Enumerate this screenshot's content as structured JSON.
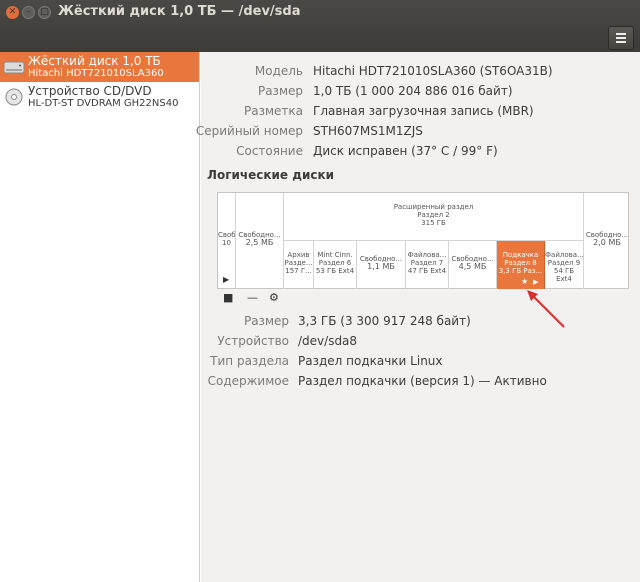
{
  "window": {
    "title": "Жёсткий диск 1,0 ТБ — /dev/sda"
  },
  "sidebar": {
    "devices": [
      {
        "name": "Жёсткий диск 1,0 ТБ",
        "sub": "Hitachi HDT721010SLA360",
        "icon": "hard-disk-icon",
        "selected": true
      },
      {
        "name": "Устройство CD/DVD",
        "sub": "HL-DT-ST DVDRAM GH22NS40",
        "icon": "optical-disc-icon",
        "selected": false
      }
    ]
  },
  "disk_info": [
    {
      "key": "Модель",
      "value": "Hitachi HDT721010SLA360 (ST6OA31B)"
    },
    {
      "key": "Размер",
      "value": "1,0 ТБ (1 000 204 886 016 байт)"
    },
    {
      "key": "Разметка",
      "value": "Главная загрузочная запись (MBR)"
    },
    {
      "key": "Серийный номер",
      "value": "STH607MS1M1ZJS"
    },
    {
      "key": "Состояние",
      "value": "Диск исправен (37° C / 99° F)"
    }
  ],
  "volumes_title": "Логические диски",
  "partitions": {
    "top_row": [
      {
        "l1": "Своб",
        "l2": "10"
      },
      {
        "l1": "Свободно...",
        "l2": "2,5 МБ"
      },
      {
        "l1": "Расширенный раздел",
        "l2": "Раздел 2",
        "l3": "315 ГБ"
      },
      {
        "l1": "Свободно...",
        "l2": "2,0 МБ"
      }
    ],
    "inner_row": [
      {
        "l1": "Архив",
        "l2": "Разде...",
        "l3": "157 Г..."
      },
      {
        "l1": "Mint Cinn.",
        "l2": "Раздел 6",
        "l3": "53 ГБ Ext4"
      },
      {
        "l1": "Свободно...",
        "l2": "1,1 МБ"
      },
      {
        "l1": "Файлова...",
        "l2": "Раздел 7",
        "l3": "47 ГБ Ext4"
      },
      {
        "l1": "Свободно...",
        "l2": "4,5 МБ"
      },
      {
        "l1": "Подкачка",
        "l2": "Раздел 8",
        "l3": "3,3 ГБ Раз..."
      },
      {
        "l1": "Файлова...",
        "l2": "Раздел 9",
        "l3": "54 ГБ Ext4"
      }
    ]
  },
  "volume_info": [
    {
      "key": "Размер",
      "value": "3,3 ГБ (3 300 917 248 байт)"
    },
    {
      "key": "Устройство",
      "value": "/dev/sda8"
    },
    {
      "key": "Тип раздела",
      "value": "Раздел подкачки Linux"
    },
    {
      "key": "Содержимое",
      "value": "Раздел подкачки (версия 1) — Активно"
    }
  ],
  "colors": {
    "accent": "#e9773d",
    "titlebar": "#3c3b37",
    "arrow": "#d9302a"
  }
}
